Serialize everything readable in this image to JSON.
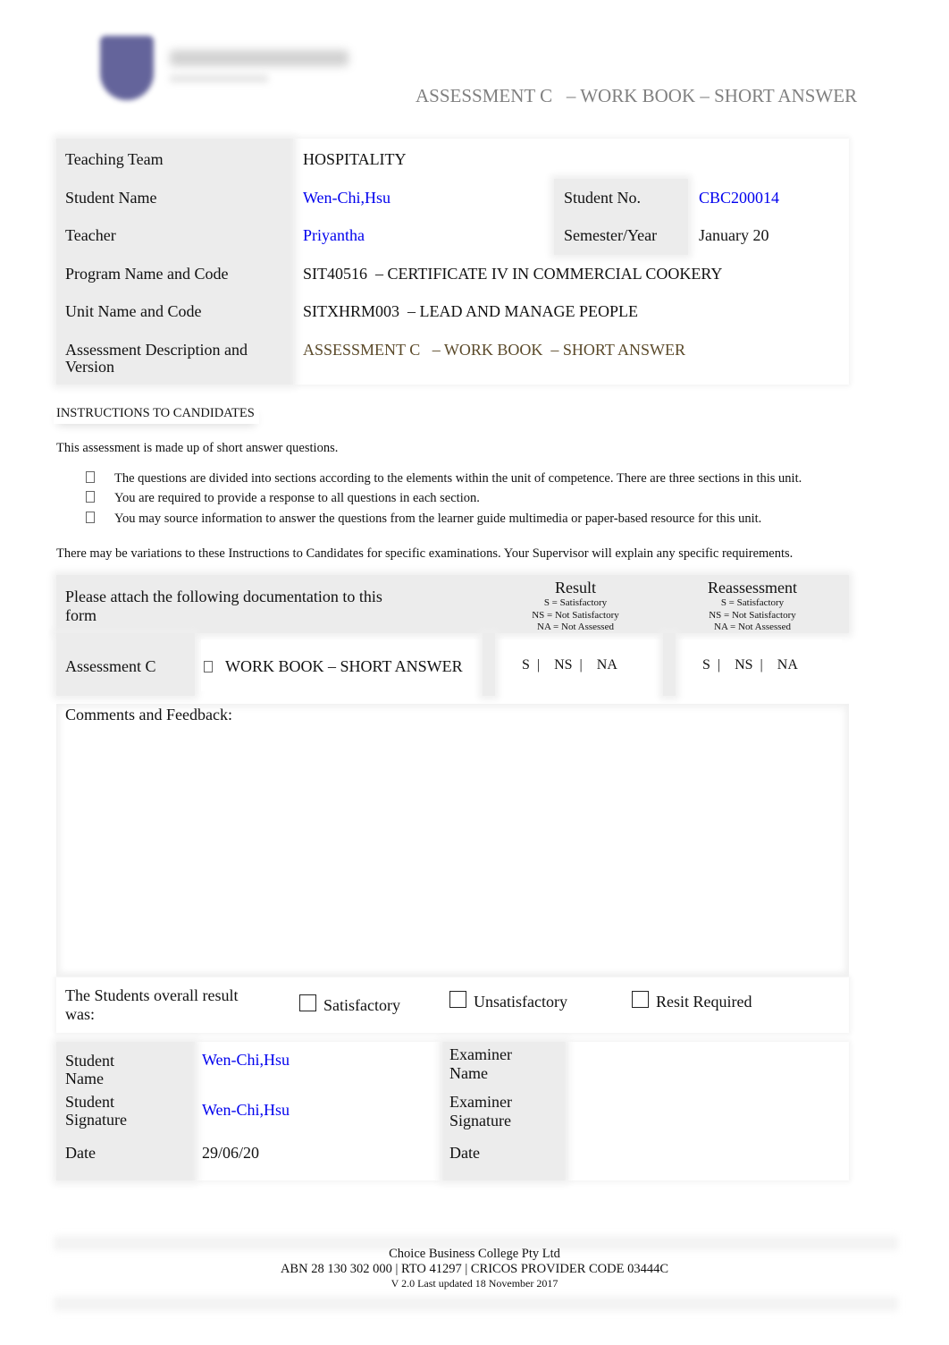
{
  "header": {
    "logo_alt": "Choice Business College logo",
    "title": "ASSESSMENT C   – WORK BOOK – SHORT ANSWER"
  },
  "info_table": {
    "teaching_team": {
      "label": "Teaching Team",
      "value": "HOSPITALITY"
    },
    "student_name": {
      "label": "Student Name",
      "value": "Wen-Chi,Hsu"
    },
    "student_no": {
      "label": "Student No.",
      "value": "CBC200014"
    },
    "teacher": {
      "label": "Teacher",
      "value": "Priyantha"
    },
    "semester_year": {
      "label": "Semester/Year",
      "value": "January 20"
    },
    "program": {
      "label": "Program Name and Code",
      "value": "SIT40516  – CERTIFICATE IV IN COMMERCIAL COOKERY"
    },
    "unit": {
      "label": "Unit Name and Code",
      "value": "SITXHRM003  – LEAD AND MANAGE PEOPLE"
    },
    "assessment": {
      "label_line1": "Assessment Description and",
      "label_line2": "Version",
      "value": "ASSESSMENT C   – WORK BOOK  – SHORT ANSWER"
    }
  },
  "instructions": {
    "heading": "INSTRUCTIONS TO CANDIDATES",
    "intro": "This assessment is made up of short answer questions.",
    "bullets": [
      "The questions are divided into sections according to the elements within the unit of competence. There are three sections in this unit.",
      "You are required to provide a response to all questions in each section.",
      "You may source information to answer the questions from the learner guide multimedia or paper-based resource for this unit."
    ],
    "note": "There may be variations to these Instructions to Candidates for specific examinations. Your Supervisor will explain any specific requirements."
  },
  "attach_table": {
    "header_line1": "Please attach the following documentation to this",
    "header_line2": "form",
    "result": {
      "title": "Result",
      "legend": [
        "S = Satisfactory",
        "NS = Not Satisfactory",
        "NA = Not Assessed"
      ]
    },
    "reassessment": {
      "title": "Reassessment",
      "legend": [
        "S = Satisfactory",
        "NS = Not Satisfactory",
        "NA = Not Assessed"
      ]
    },
    "row": {
      "label": "Assessment C",
      "item": "WORK BOOK – SHORT ANSWER",
      "result_options": "S  |    NS  |    NA",
      "reassess_options": "S  |    NS  |    NA"
    }
  },
  "comments": {
    "label": "Comments and Feedback:",
    "value": ""
  },
  "overall": {
    "label_line1": "The Students overall result",
    "label_line2": "was:",
    "options": [
      {
        "label": "Satisfactory",
        "checked": false
      },
      {
        "label": "Unsatisfactory",
        "checked": false
      },
      {
        "label": "Resit Required",
        "checked": false
      }
    ]
  },
  "signatures": {
    "student_name": {
      "label_line1": "Student",
      "label_line2": "Name",
      "value": "Wen-Chi,Hsu"
    },
    "student_signature": {
      "label_line1": "Student",
      "label_line2": "Signature",
      "value": "Wen-Chi,Hsu"
    },
    "student_date": {
      "label": "Date",
      "value": "29/06/20"
    },
    "examiner_name": {
      "label_line1": "Examiner",
      "label_line2": "Name",
      "value": ""
    },
    "examiner_signature": {
      "label_line1": "Examiner",
      "label_line2": "Signature",
      "value": ""
    },
    "examiner_date": {
      "label": "Date",
      "value": ""
    }
  },
  "footer": {
    "company": "Choice Business College Pty Ltd",
    "registration": "ABN 28 130 302 000 | RTO 41297 | CRICOS PROVIDER CODE 03444C",
    "version": "V 2.0 Last updated 18 November 2017"
  },
  "colors": {
    "value_blue": "#0000ee",
    "header_grey": "#808080",
    "assessment_olive": "#5b4a2a",
    "label_shade": "#ececec"
  }
}
